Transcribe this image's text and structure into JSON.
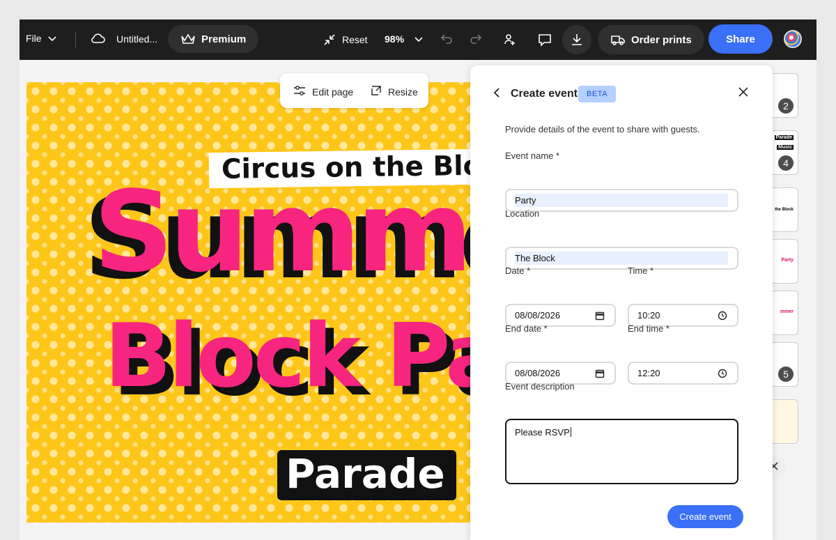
{
  "topbar": {
    "file_label": "File",
    "doc_title": "Untitled...",
    "premium_label": "Premium",
    "reset_label": "Reset",
    "zoom": "98%",
    "order_prints_label": "Order prints",
    "share_label": "Share"
  },
  "edit_toolbar": {
    "edit_page_label": "Edit page",
    "resize_label": "Resize"
  },
  "canvas": {
    "subtitle": "Circus on the Block",
    "headline_1": "Summer",
    "headline_2": "Block Party",
    "tag": "Parade"
  },
  "pages": {
    "thumb_texts": [
      "Parade",
      "Music",
      "the Block",
      "Party",
      "mmer"
    ],
    "badges": [
      "2",
      "4",
      "5"
    ]
  },
  "panel": {
    "title": "Create event",
    "badge": "BETA",
    "description": "Provide details of the event to share with guests.",
    "event_name_label": "Event name *",
    "event_name_value": "Party",
    "location_label": "Location",
    "location_value": "The Block",
    "date_label": "Date *",
    "date_value": "08/08/2026",
    "time_label": "Time *",
    "time_value": "10:20",
    "end_date_label": "End date *",
    "end_date_value": "08/08/2026",
    "end_time_label": "End time *",
    "end_time_value": "12:20",
    "event_description_label": "Event description",
    "event_description_value": "Please RSVP",
    "create_button_label": "Create event"
  },
  "colors": {
    "accent": "#3a6ff7",
    "topbar_bg": "#1e1e1e",
    "canvas_bg": "#ffc61a",
    "headline": "#f7257f",
    "beta_bg": "#b3d0ff"
  }
}
